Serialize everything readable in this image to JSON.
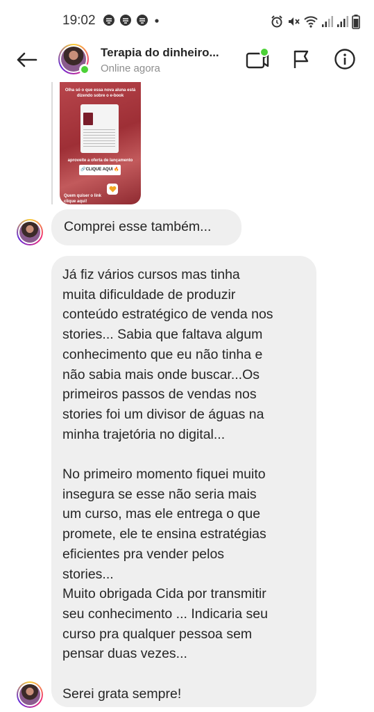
{
  "status_bar": {
    "time": "19:02",
    "left_icons": [
      "threads-icon",
      "threads-icon",
      "threads-icon",
      "dot-icon"
    ],
    "right_icons": [
      "alarm-icon",
      "mute-icon",
      "wifi-icon",
      "signal-icon",
      "signal-icon",
      "battery-icon"
    ]
  },
  "header": {
    "contact_name": "Terapia do dinheiro...",
    "contact_status": "Online agora",
    "online_color": "#4cd137"
  },
  "story": {
    "top_text": "Olha só o que essa nova aluna está dizendo sobre o e-book",
    "caption": "aproveite a oferta de lançamento",
    "cta": "🔗CLIQUE AQUI 🔥",
    "bottom_text": "Quem quiser o link clique aqui!"
  },
  "messages": [
    {
      "text": "Comprei esse também..."
    },
    {
      "paragraphs": [
        "Já fiz vários cursos mas tinha\nmuita dificuldade de produzir\nconteúdo estratégico de venda nos\nstories... Sabia que faltava algum\nconhecimento que eu não tinha e\nnão sabia mais onde buscar...Os\nprimeiros passos de vendas nos\nstories foi um divisor de águas na\nminha trajetória no digital...",
        "No primeiro momento fiquei muito\ninsegura se esse não seria mais\num curso, mas ele entrega o que\npromete, ele te ensina estratégias\neficientes pra vender pelos\nstories...\nMuito obrigada Cida por transmitir\nseu conhecimento ... Indicaria seu\ncurso pra qualquer pessoa sem\npensar duas vezes...",
        "Serei grata sempre!"
      ]
    }
  ]
}
